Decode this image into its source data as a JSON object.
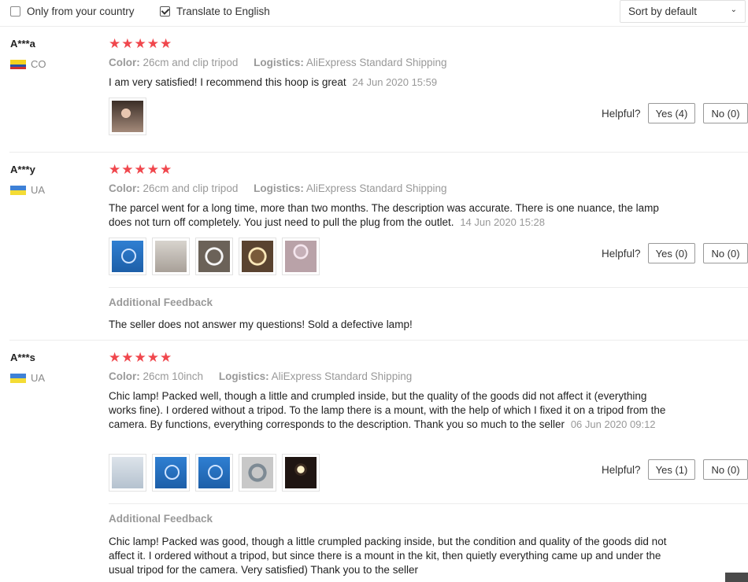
{
  "filters": {
    "only_country_label": "Only from your country",
    "only_country_checked": false,
    "translate_label": "Translate to English",
    "translate_checked": true,
    "sort_value": "Sort by default"
  },
  "reviews": [
    {
      "user": "A***a",
      "country": "CO",
      "stars": "★★★★★",
      "color_label": "Color:",
      "color_value": "26cm and clip tripod",
      "logistics_label": "Logistics:",
      "logistics_value": "AliExpress Standard Shipping",
      "text": "I am very satisfied! I recommend this hoop is great",
      "date": "24 Jun 2020 15:59",
      "helpful_label": "Helpful?",
      "yes_label": "Yes (4)",
      "no_label": "No (0)"
    },
    {
      "user": "A***y",
      "country": "UA",
      "stars": "★★★★★",
      "color_label": "Color:",
      "color_value": "26cm and clip tripod",
      "logistics_label": "Logistics:",
      "logistics_value": "AliExpress Standard Shipping",
      "text": "The parcel went for a long time, more than two months. The description was accurate. There is one nuance, the lamp does not turn off completely. You just need to pull the plug from the outlet.",
      "date": "14 Jun 2020 15:28",
      "helpful_label": "Helpful?",
      "yes_label": "Yes (0)",
      "no_label": "No (0)",
      "additional_title": "Additional Feedback",
      "additional_text": "The seller does not answer my questions! Sold a defective lamp!"
    },
    {
      "user": "A***s",
      "country": "UA",
      "stars": "★★★★★",
      "color_label": "Color:",
      "color_value": "26cm 10inch",
      "logistics_label": "Logistics:",
      "logistics_value": "AliExpress Standard Shipping",
      "text": "Chic lamp! Packed well, though a little and crumpled inside, but the quality of the goods did not affect it (everything works fine). I ordered without a tripod. To the lamp there is a mount, with the help of which I fixed it on a tripod from the camera. By functions, everything corresponds to the description. Thank you so much to the seller",
      "date": "06 Jun 2020 09:12",
      "helpful_label": "Helpful?",
      "yes_label": "Yes (1)",
      "no_label": "No (0)",
      "additional_title": "Additional Feedback",
      "additional_text": "Chic lamp! Packed was good, though a little crumpled packing inside, but the condition and quality of the goods did not affect it. I ordered without a tripod, but since there is a mount in the kit, then quietly everything came up and under the usual tripod for the camera. Very satisfied) Thank you to the seller"
    }
  ]
}
